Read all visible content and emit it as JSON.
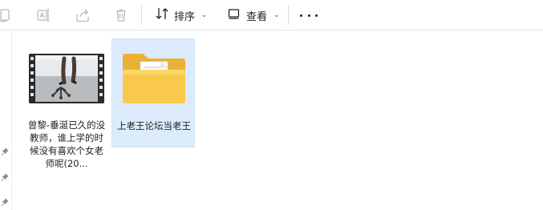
{
  "toolbar": {
    "sort_label": "排序",
    "view_label": "查看",
    "icons": [
      "copy-icon",
      "rename-icon",
      "share-icon",
      "delete-icon",
      "sort-icon",
      "view-icon",
      "more-icon"
    ]
  },
  "files": [
    {
      "name": "曾黎-垂涎已久的没教师，谁上学的时候没有喜欢个女老师呢(20...",
      "type": "video",
      "selected": false
    },
    {
      "name": "上老王论坛当老王",
      "type": "folder",
      "selected": true
    }
  ],
  "colors": {
    "selection_bg": "#dcebfc",
    "folder_yellow": "#f8c94a",
    "toolbar_icon_disabled": "#b9b9b9"
  }
}
